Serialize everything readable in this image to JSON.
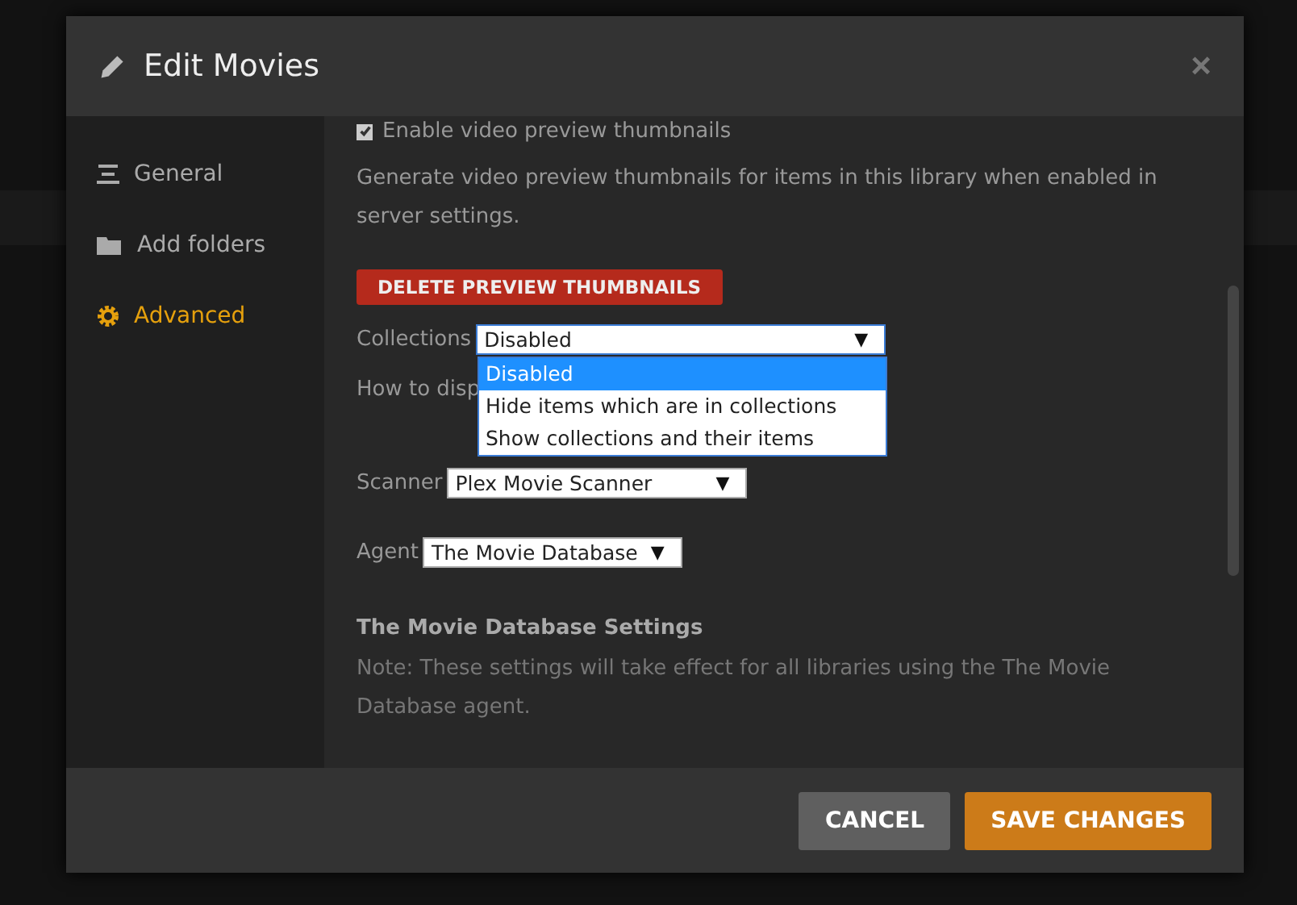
{
  "dialog": {
    "title": "Edit Movies",
    "close": "×"
  },
  "sidebar": {
    "items": [
      {
        "label": "General",
        "kind": "lines",
        "selected": false
      },
      {
        "label": "Add folders",
        "kind": "folder",
        "selected": false
      },
      {
        "label": "Advanced",
        "kind": "gear",
        "selected": true
      }
    ]
  },
  "content": {
    "thumbnails": {
      "label": "Enable video preview thumbnails",
      "checked": true
    },
    "thumbnails_help": "Generate video preview thumbnails for items in this library when enabled in server settings.",
    "delete_button": "DELETE PREVIEW THUMBNAILS",
    "collections": {
      "label": "Collections",
      "value": "Disabled",
      "caret": "▼",
      "options": [
        {
          "label": "Disabled",
          "selected": true
        },
        {
          "label": "Hide items which are in collections",
          "selected": false
        },
        {
          "label": "Show collections and their items",
          "selected": false
        }
      ]
    },
    "collections_help": "How to disp",
    "scanner": {
      "label": "Scanner",
      "value": "Plex Movie Scanner",
      "caret": "▼"
    },
    "agent": {
      "label": "Agent",
      "value": "The Movie Database",
      "caret": "▼"
    },
    "agent_settings_title": "The Movie Database Settings",
    "agent_settings_note": "Note: These settings will take effect for all libraries using the The Movie Database agent."
  },
  "footer": {
    "cancel": "CANCEL",
    "save": "SAVE CHANGES"
  }
}
